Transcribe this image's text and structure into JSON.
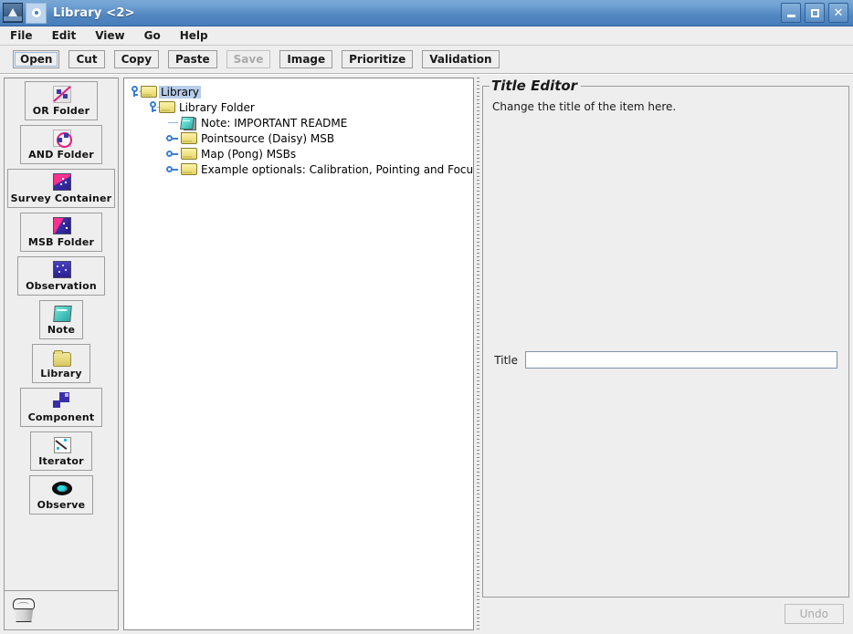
{
  "window": {
    "title": "Library <2>",
    "app_icon": "ship-icon",
    "doc_icon": "document-ring-icon",
    "controls": {
      "minimize": "minimize-icon",
      "maximize": "maximize-icon",
      "close": "close-icon"
    }
  },
  "menubar": {
    "items": [
      {
        "label": "File"
      },
      {
        "label": "Edit"
      },
      {
        "label": "View"
      },
      {
        "label": "Go"
      },
      {
        "label": "Help"
      }
    ]
  },
  "toolbar": {
    "buttons": [
      {
        "label": "Open",
        "state": "focused"
      },
      {
        "label": "Cut",
        "state": "normal"
      },
      {
        "label": "Copy",
        "state": "normal"
      },
      {
        "label": "Paste",
        "state": "normal"
      },
      {
        "label": "Save",
        "state": "disabled"
      },
      {
        "label": "Image",
        "state": "normal"
      },
      {
        "label": "Prioritize",
        "state": "normal"
      },
      {
        "label": "Validation",
        "state": "normal"
      }
    ]
  },
  "palette": {
    "items": [
      {
        "label": "OR Folder",
        "icon": "or-folder-icon"
      },
      {
        "label": "AND Folder",
        "icon": "and-folder-icon"
      },
      {
        "label": "Survey Container",
        "icon": "survey-container-icon"
      },
      {
        "label": "MSB Folder",
        "icon": "msb-folder-icon"
      },
      {
        "label": "Observation",
        "icon": "observation-icon"
      },
      {
        "label": "Note",
        "icon": "note-icon"
      },
      {
        "label": "Library",
        "icon": "library-folder-icon"
      },
      {
        "label": "Component",
        "icon": "component-icon"
      },
      {
        "label": "Iterator",
        "icon": "iterator-icon"
      },
      {
        "label": "Observe",
        "icon": "observe-eye-icon"
      }
    ],
    "trash_icon": "trash-can-icon"
  },
  "tree": {
    "nodes": [
      {
        "label": "Library",
        "icon": "folder-icon",
        "depth": 0,
        "handle": "expanded",
        "selected": true
      },
      {
        "label": "Library Folder",
        "icon": "folder-icon",
        "depth": 1,
        "handle": "expanded",
        "selected": false
      },
      {
        "label": "Note: IMPORTANT README",
        "icon": "note-icon",
        "depth": 2,
        "handle": "leaf",
        "selected": false
      },
      {
        "label": "Pointsource (Daisy)  MSB",
        "icon": "folder-icon",
        "depth": 2,
        "handle": "collapsed",
        "selected": false
      },
      {
        "label": "Map (Pong)  MSBs",
        "icon": "folder-icon",
        "depth": 2,
        "handle": "collapsed",
        "selected": false
      },
      {
        "label": "Example optionals: Calibration, Pointing and Focus",
        "icon": "folder-icon",
        "depth": 2,
        "handle": "collapsed",
        "selected": false
      }
    ]
  },
  "editor": {
    "group_title": "Title Editor",
    "hint": "Change the title of the item here.",
    "title_label": "Title",
    "title_value": "",
    "title_placeholder": "",
    "undo_label": "Undo",
    "undo_state": "disabled"
  },
  "colors": {
    "titlebar_blue": "#5287c0",
    "selection_blue": "#b7cde9",
    "panel_gray": "#eeeeee",
    "tree_handle_blue": "#3b7fd4",
    "folder_yellow": "#e4d46a",
    "accent_pink": "#ff2f8e"
  }
}
